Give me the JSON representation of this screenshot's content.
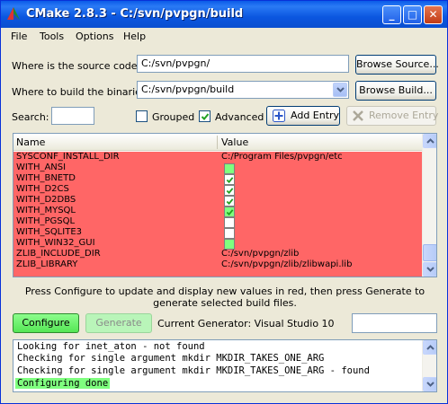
{
  "window": {
    "title": "CMake 2.8.3 - C:/svn/pvpgn/build",
    "minimize": "_",
    "maximize": "□",
    "close": "✕"
  },
  "menu": [
    "File",
    "Tools",
    "Options",
    "Help"
  ],
  "source": {
    "label": "Where is the source code:",
    "value": "C:/svn/pvpgn/",
    "browse_label": "Browse Source..."
  },
  "build": {
    "label": "Where to build the binaries:",
    "value": "C:/svn/pvpgn/build",
    "browse_label": "Browse Build..."
  },
  "search": {
    "label": "Search:",
    "value": ""
  },
  "options": {
    "grouped_label": "Grouped",
    "grouped_checked": false,
    "advanced_label": "Advanced",
    "advanced_checked": true,
    "add_entry_label": "Add Entry",
    "remove_entry_label": "Remove Entry"
  },
  "table": {
    "columns": [
      "Name",
      "Value"
    ],
    "rows": [
      {
        "name": "SYSCONF_INSTALL_DIR",
        "type": "text",
        "value": "C:/Program Files/pvpgn/etc"
      },
      {
        "name": "WITH_ANSI",
        "type": "bool",
        "checked": false,
        "green": true
      },
      {
        "name": "WITH_BNETD",
        "type": "bool",
        "checked": true,
        "green": false
      },
      {
        "name": "WITH_D2CS",
        "type": "bool",
        "checked": true,
        "green": false
      },
      {
        "name": "WITH_D2DBS",
        "type": "bool",
        "checked": true,
        "green": false
      },
      {
        "name": "WITH_MYSQL",
        "type": "bool",
        "checked": true,
        "green": true
      },
      {
        "name": "WITH_PGSQL",
        "type": "bool",
        "checked": false,
        "green": false
      },
      {
        "name": "WITH_SQLITE3",
        "type": "bool",
        "checked": false,
        "green": false
      },
      {
        "name": "WITH_WIN32_GUI",
        "type": "bool",
        "checked": false,
        "green": true
      },
      {
        "name": "ZLIB_INCLUDE_DIR",
        "type": "text",
        "value": "C:/svn/pvpgn/zlib"
      },
      {
        "name": "ZLIB_LIBRARY",
        "type": "text",
        "value": "C:/svn/pvpgn/zlib/zlibwapi.lib"
      }
    ],
    "row_color": "#ff6666"
  },
  "info_text": "Press Configure to update and display new values in red, then press Generate to generate selected build files.",
  "actions": {
    "configure_label": "Configure",
    "generate_label": "Generate",
    "generator_text": "Current Generator: Visual Studio 10"
  },
  "output": {
    "lines": [
      "Looking for inet_aton - not found",
      "Checking for single argument mkdir MKDIR_TAKES_ONE_ARG",
      "Checking for single argument mkdir MKDIR_TAKES_ONE_ARG - found",
      "Configuring done"
    ]
  }
}
